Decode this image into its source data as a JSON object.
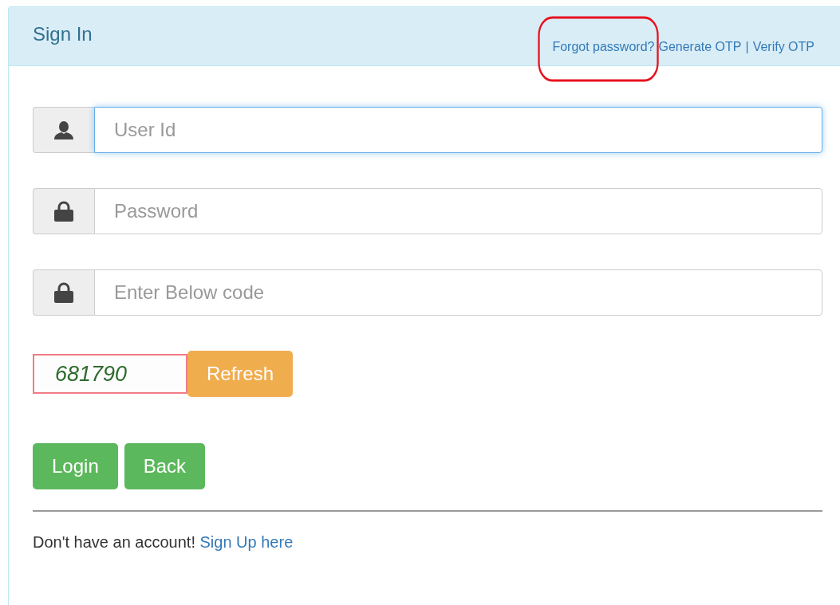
{
  "panel": {
    "title": "Sign In",
    "header_links": [
      {
        "kind": "link",
        "label": "Forgot password?",
        "circled": true
      },
      {
        "kind": "link",
        "label": "Generate OTP",
        "circled": false
      },
      {
        "kind": "separator",
        "label": "|"
      },
      {
        "kind": "link",
        "label": "Verify OTP",
        "circled": false
      }
    ]
  },
  "fields": [
    {
      "kind": "user",
      "placeholder": "User Id",
      "focused": true
    },
    {
      "kind": "lock",
      "placeholder": "Password",
      "focused": false
    },
    {
      "kind": "lock",
      "placeholder": "Enter Below code",
      "focused": false
    }
  ],
  "captcha": {
    "code": "681790",
    "refresh": "Refresh"
  },
  "buttons": [
    "Login",
    "Back"
  ],
  "footer": {
    "text": "Don't have an account!",
    "link": "Sign Up here"
  }
}
